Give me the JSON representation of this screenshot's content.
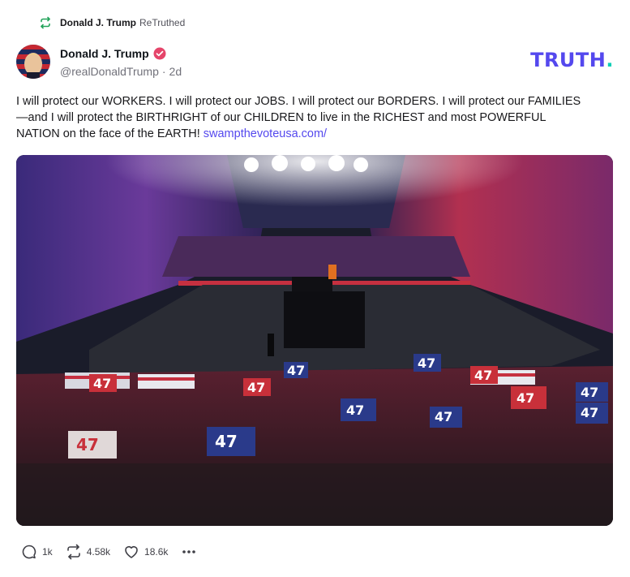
{
  "retruth": {
    "name": "Donald J. Trump",
    "label": "ReTruthed"
  },
  "author": {
    "display_name": "Donald J. Trump",
    "handle": "@realDonaldTrump",
    "age": "2d",
    "verified": true
  },
  "brand": {
    "word": "TRUTH",
    "dot": "."
  },
  "post": {
    "text": "I will protect our WORKERS. I will protect our JOBS. I will protect our BORDERS. I will protect our FAMILIES—and I will protect the BIRTHRIGHT of our CHILDREN to live in the RICHEST and most POWERFUL NATION on the face of the EARTH! ",
    "link": "swampthevoteusa.com/"
  },
  "media": {
    "sign_text": "47"
  },
  "actions": {
    "replies": "1k",
    "retruths": "4.58k",
    "likes": "18.6k"
  },
  "colors": {
    "accent": "#5448ee",
    "brand_dot": "#0ccfb6",
    "retruth_green": "#22a35a",
    "verified": "#e5456a"
  }
}
